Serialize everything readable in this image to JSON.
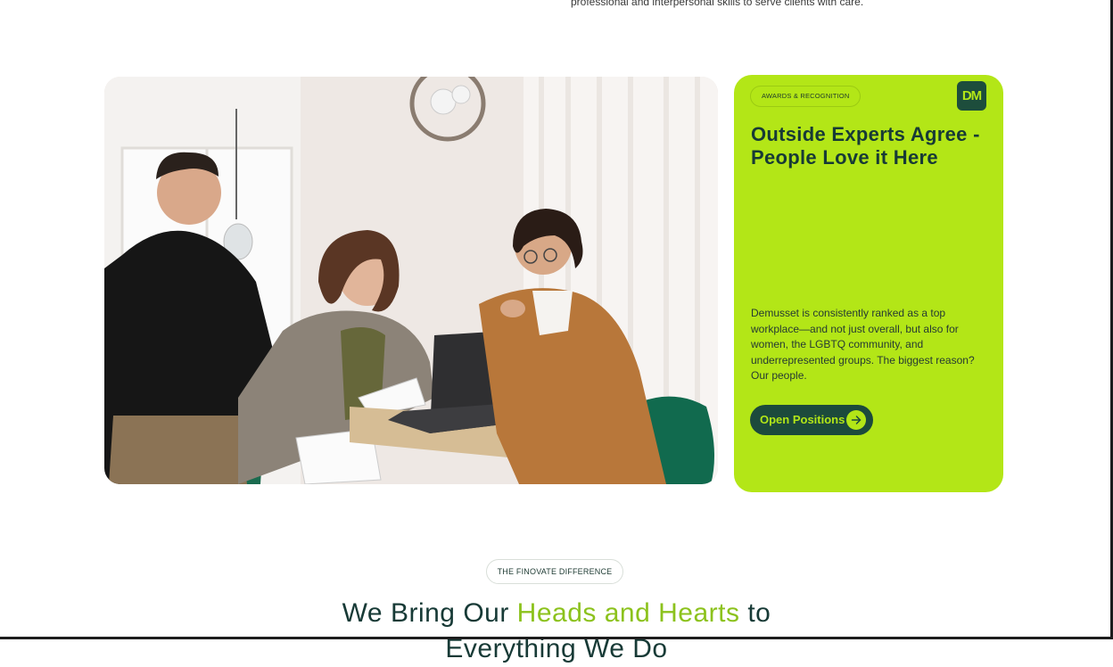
{
  "intro": {
    "tail_text": "professional and interpersonal skills to serve clients with care."
  },
  "photo": {
    "icon": "team-meeting-photo",
    "alt": "Three colleagues smiling around a laptop at a table"
  },
  "awards_card": {
    "badge": "AWARDS & RECOGNITION",
    "logo_text": "DM",
    "title": "Outside Experts Agree - People Love it Here",
    "description": "Demusset is consistently ranked as a top workplace—and not just overall, but also for women, the LGBTQ community, and underrepresented groups. The biggest reason? Our people.",
    "button_label": "Open Positions",
    "button_icon": "arrow-right-icon"
  },
  "difference_section": {
    "badge": "THE FINOVATE DIFFERENCE",
    "title_start": "We Bring Our ",
    "title_highlight": "Heads and Hearts",
    "title_end": " to",
    "title_line2": "Everything We Do"
  },
  "colors": {
    "accent_green": "#b3e617",
    "dark_green": "#1c4a3c",
    "text_dark": "#173a36",
    "highlight": "#8cc21d"
  }
}
